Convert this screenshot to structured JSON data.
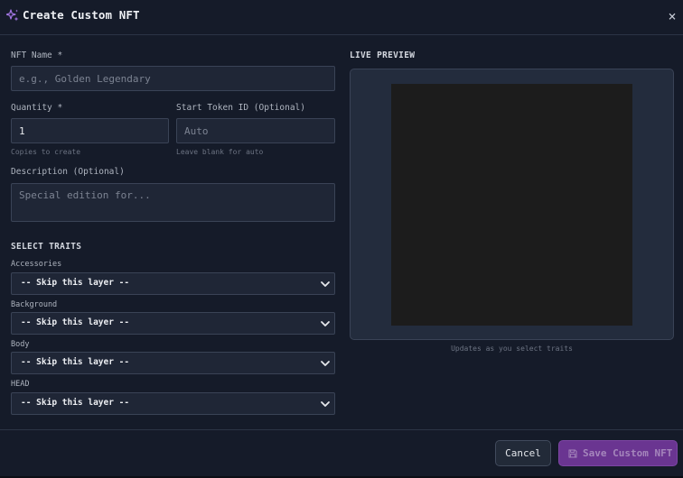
{
  "header": {
    "title": "Create Custom NFT",
    "title_icon": "sparkles-icon",
    "close_label": "×",
    "accent_color": "#a678e8"
  },
  "form": {
    "nft_name": {
      "label": "NFT Name *",
      "placeholder": "e.g., Golden Legendary",
      "value": ""
    },
    "quantity": {
      "label": "Quantity *",
      "value": "1",
      "hint": "Copies to create"
    },
    "start_token": {
      "label": "Start Token ID (Optional)",
      "placeholder": "Auto",
      "hint": "Leave blank for auto"
    },
    "description": {
      "label": "Description (Optional)",
      "placeholder": "Special edition for..."
    }
  },
  "traits": {
    "section_title": "SELECT TRAITS",
    "layers": [
      {
        "label": "Accessories",
        "selected": "-- Skip this layer --"
      },
      {
        "label": "Background",
        "selected": "-- Skip this layer --"
      },
      {
        "label": "Body",
        "selected": "-- Skip this layer --"
      },
      {
        "label": "HEAD",
        "selected": "-- Skip this layer --"
      }
    ]
  },
  "preview": {
    "title": "LIVE PREVIEW",
    "hint": "Updates as you select traits"
  },
  "footer": {
    "cancel_label": "Cancel",
    "save_label": "Save Custom NFT",
    "save_icon": "floppy-disk-icon",
    "save_color": "#6a3591"
  }
}
